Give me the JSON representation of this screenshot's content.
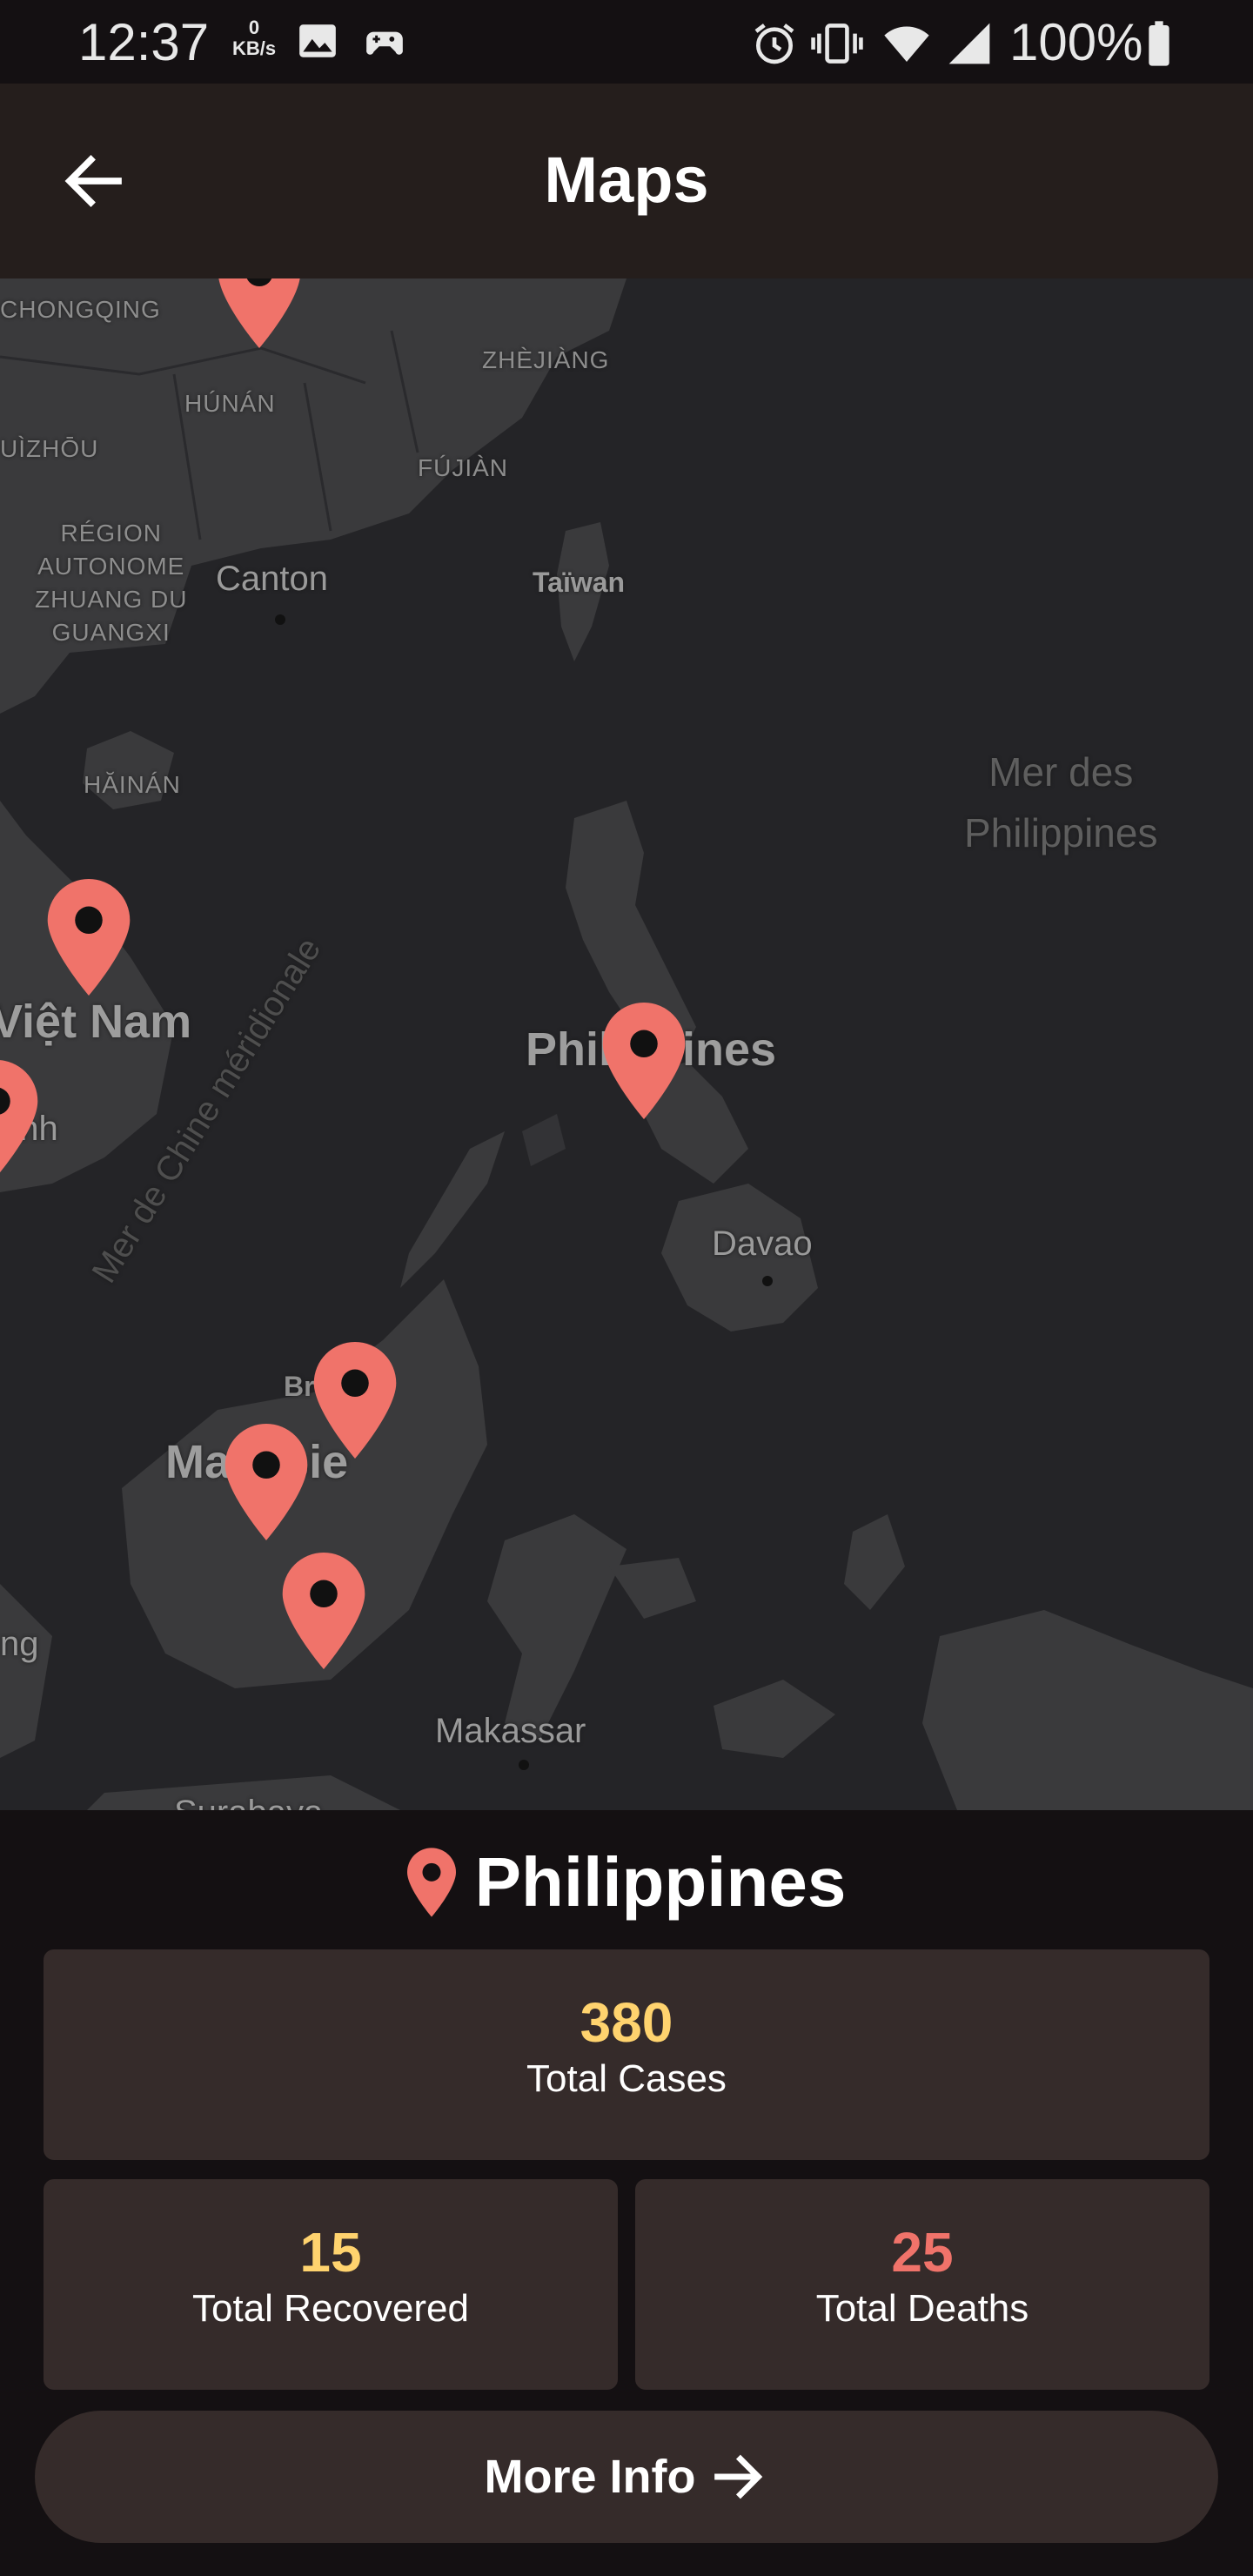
{
  "status_bar": {
    "time": "12:37",
    "net_speed_value": "0",
    "net_speed_unit": "KB/s",
    "battery": "100%",
    "icons": [
      "image-icon",
      "game-controller-icon",
      "alarm-icon",
      "vibrate-icon",
      "wifi-icon",
      "signal-icon",
      "battery-icon"
    ]
  },
  "app_bar": {
    "title": "Maps",
    "back_icon": "arrow-left-icon"
  },
  "map": {
    "labels": {
      "chongqing": "CHONGQING",
      "hunan": "HÚNÁN",
      "zhejiang": "ZHÈJIÀNG",
      "guizhou": "UÌZHŌU",
      "fujian": "FÚJIÀN",
      "guangxi": "RÉGION\nAUTONOME\nZHUANG DU\nGUANGXI",
      "canton": "Canton",
      "taiwan": "Taïwan",
      "hainan": "HĂINÁN",
      "vietnam": "Việt Nam",
      "phnom_penh": "enh",
      "philippines": "Philippines",
      "philippine_sea": "Mer des\nPhilippines",
      "south_china_sea": "Mer de Chine méridionale",
      "davao": "Davao",
      "brunei": "Brunei",
      "malaysia": "Malaisie",
      "kuching": "ng",
      "makassar": "Makassar",
      "surabaya": "Surabaya"
    },
    "marker_color": "#f0736a",
    "marker_icon": "map-pin-icon"
  },
  "panel": {
    "country": "Philippines",
    "total_cases": {
      "value": "380",
      "label": "Total Cases",
      "color": "#ffd36e"
    },
    "total_recovered": {
      "value": "15",
      "label": "Total Recovered",
      "color": "#ffd36e"
    },
    "total_deaths": {
      "value": "25",
      "label": "Total Deaths",
      "color": "#f0736a"
    },
    "more_info": "More Info"
  },
  "colors": {
    "background": "#141012",
    "app_bar": "#251e1c",
    "card": "#352b2a",
    "map_water": "#242427",
    "map_land": "#3a3a3c"
  }
}
